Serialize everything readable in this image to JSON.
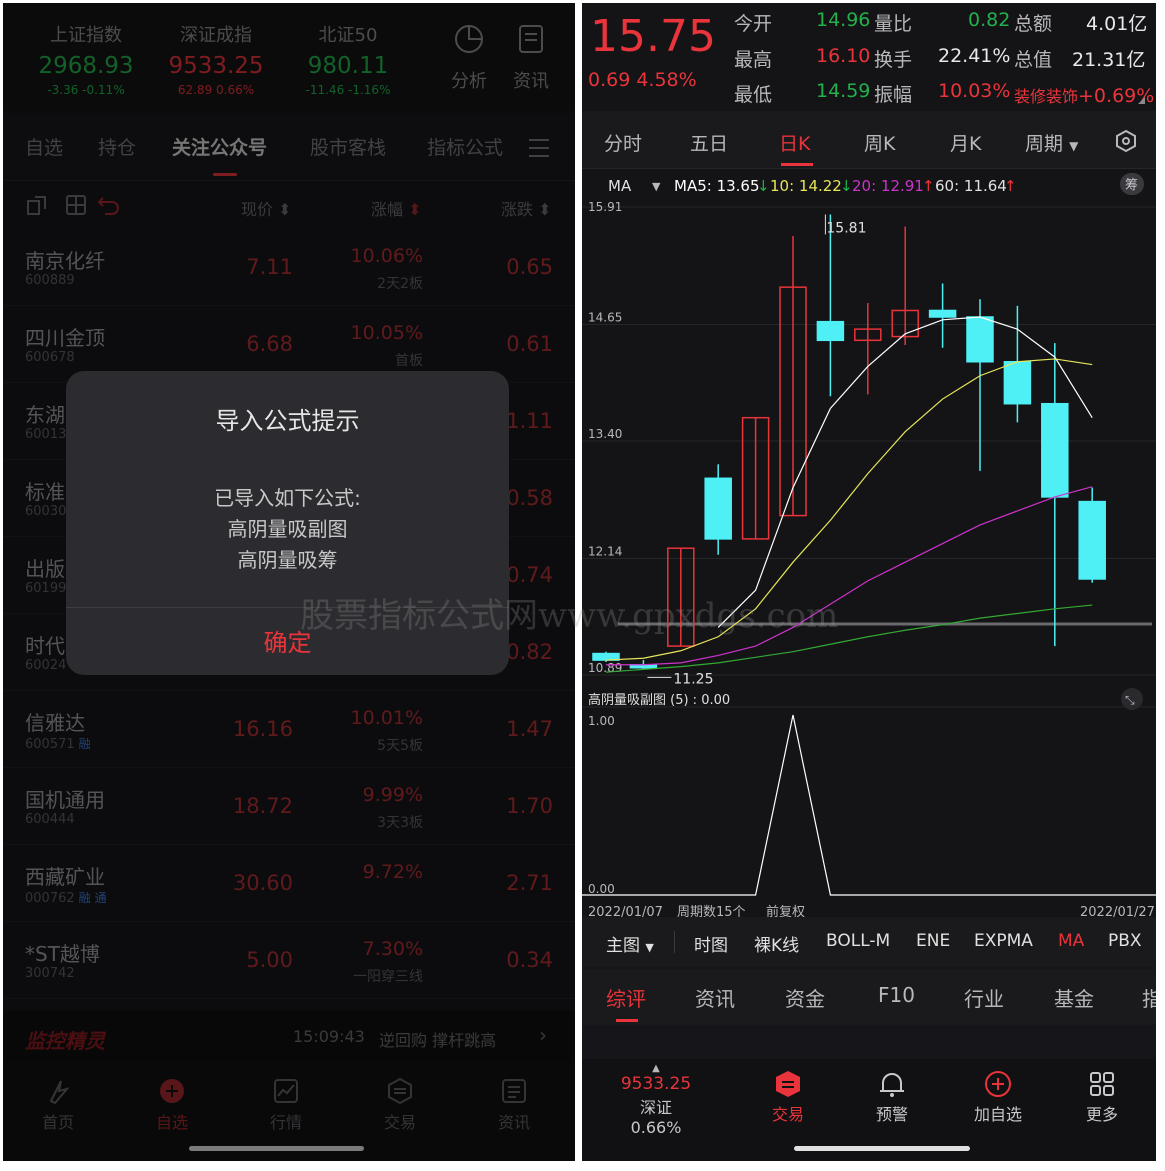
{
  "left": {
    "indices": [
      {
        "name": "上证指数",
        "value": "2968.93",
        "change": "-3.36  -0.11%",
        "up": false
      },
      {
        "name": "深证成指",
        "value": "9533.25",
        "change": "62.89  0.66%",
        "up": true
      },
      {
        "name": "北证50",
        "value": "980.11",
        "change": "-11.46  -1.16%",
        "up": false
      }
    ],
    "top_buttons": {
      "analysis": "分析",
      "news": "资讯"
    },
    "tabs": [
      "自选",
      "持仓",
      "关注公众号",
      "股市客栈",
      "指标公式"
    ],
    "columns": {
      "price": "现价",
      "pct": "涨幅",
      "chg": "涨跌"
    },
    "stocks": [
      {
        "name": "南京化纤",
        "code": "600889",
        "badge": "",
        "badge2": "",
        "price": "7.11",
        "pct": "10.06%",
        "sub": "2天2板",
        "chg": "0.65"
      },
      {
        "name": "四川金顶",
        "code": "600678",
        "badge": "",
        "badge2": "",
        "price": "6.68",
        "pct": "10.05%",
        "sub": "首板",
        "chg": "0.61"
      },
      {
        "name": "东湖",
        "code": "60013",
        "badge": "",
        "badge2": "",
        "price": "",
        "pct": "",
        "sub": "",
        "chg": "1.11"
      },
      {
        "name": "标准",
        "code": "60030",
        "badge": "",
        "badge2": "",
        "price": "",
        "pct": "",
        "sub": "",
        "chg": "0.58"
      },
      {
        "name": "出版",
        "code": "60199",
        "badge": "",
        "badge2": "",
        "price": "",
        "pct": "",
        "sub": "",
        "chg": "0.74"
      },
      {
        "name": "时代",
        "code": "60024",
        "badge": "",
        "badge2": "",
        "price": "",
        "pct": "",
        "sub": "",
        "chg": "0.82"
      },
      {
        "name": "信雅达",
        "code": "600571",
        "badge": "融",
        "badge2": "",
        "price": "16.16",
        "pct": "10.01%",
        "sub": "5天5板",
        "chg": "1.47"
      },
      {
        "name": "国机通用",
        "code": "600444",
        "badge": "",
        "badge2": "",
        "price": "18.72",
        "pct": "9.99%",
        "sub": "3天3板",
        "chg": "1.70"
      },
      {
        "name": "西藏矿业",
        "code": "000762",
        "badge": "融",
        "badge2": "通",
        "price": "30.60",
        "pct": "9.72%",
        "sub": "",
        "chg": "2.71"
      },
      {
        "name": "*ST越博",
        "code": "300742",
        "badge": "",
        "badge2": "",
        "price": "5.00",
        "pct": "7.30%",
        "sub": "一阳穿三线",
        "chg": "0.34"
      }
    ],
    "dialog": {
      "title": "导入公式提示",
      "line1": "已导入如下公式:",
      "line2": "高阴量吸副图",
      "line3": "高阴量吸筹",
      "ok": "确定"
    },
    "monitor": {
      "brand": "监控精灵",
      "time": "15:09:43",
      "text": "逆回购   撑杆跳高"
    },
    "nav": [
      "首页",
      "自选",
      "行情",
      "交易",
      "资讯"
    ]
  },
  "right": {
    "price": "15.75",
    "change": "0.69  4.58%",
    "quote": {
      "open_label": "今开",
      "open": "14.96",
      "high_label": "最高",
      "high": "16.10",
      "low_label": "最低",
      "low": "14.59",
      "vr_label": "量比",
      "vr": "0.82",
      "turn_label": "换手",
      "turn": "22.41%",
      "amp_label": "振幅",
      "amp": "10.03%",
      "amt_label": "总额",
      "amt": "4.01亿",
      "cap_label": "总值",
      "cap": "21.31亿",
      "sector": "装修装饰",
      "sector_pct": "+0.69%"
    },
    "ktabs": [
      "分时",
      "五日",
      "日K",
      "周K",
      "月K",
      "周期"
    ],
    "ma": {
      "label": "MA",
      "ma5": "MA5: 13.65",
      "ma10": "10: 14.22",
      "ma20": "20: 12.91",
      "ma60": "60: 11.64",
      "chip": "筹"
    },
    "sub_title": "高阴量吸副图 (5) : 0.00",
    "footer": {
      "start": "2022/01/07",
      "count": "周期数15个",
      "adj": "前复权",
      "end": "2022/01/27"
    },
    "subtabs": [
      "主图",
      "时图",
      "裸K线",
      "BOLL-M",
      "ENE",
      "EXPMA",
      "MA",
      "PBX"
    ],
    "ftabs": [
      "综评",
      "资讯",
      "资金",
      "F10",
      "行业",
      "基金",
      "指"
    ],
    "bottom": {
      "index_value": "9533.25",
      "index_name": "深证 0.66%",
      "trade": "交易",
      "alert": "预警",
      "add": "加自选",
      "more": "更多"
    },
    "watermark": "股票指标公式网www.gpxdgs.com",
    "colors": {
      "up": "#e8343a",
      "down": "#4ff0f5",
      "ma5": "#ffffff",
      "ma10": "#e6e65a",
      "ma20": "#cc33cc",
      "ma60": "#33aa33"
    }
  },
  "chart_data": [
    {
      "type": "candlestick",
      "title": "日K",
      "ylim": [
        10.89,
        15.91
      ],
      "y_ticks": [
        "15.91",
        "14.65",
        "13.40",
        "12.14",
        "10.89"
      ],
      "annotations": [
        "15.81",
        "11.25"
      ],
      "candles": [
        {
          "open": 11.12,
          "close": 11.05,
          "high": 11.14,
          "low": 11.03
        },
        {
          "open": 11.0,
          "close": 10.98,
          "high": 11.05,
          "low": 10.95
        },
        {
          "open": 11.2,
          "close": 12.25,
          "high": 12.25,
          "low": 11.2
        },
        {
          "open": 13.0,
          "close": 12.35,
          "high": 13.15,
          "low": 12.18
        },
        {
          "open": 12.35,
          "close": 13.65,
          "high": 13.65,
          "low": 12.35
        },
        {
          "open": 12.6,
          "close": 15.05,
          "high": 15.6,
          "low": 12.6
        },
        {
          "open": 14.68,
          "close": 14.48,
          "high": 15.83,
          "low": 13.88
        },
        {
          "open": 14.48,
          "close": 14.6,
          "high": 14.88,
          "low": 13.9
        },
        {
          "open": 14.52,
          "close": 14.8,
          "high": 15.7,
          "low": 14.43
        },
        {
          "open": 14.8,
          "close": 14.73,
          "high": 15.09,
          "low": 14.4
        },
        {
          "open": 14.73,
          "close": 14.25,
          "high": 14.92,
          "low": 13.08
        },
        {
          "open": 14.25,
          "close": 13.8,
          "high": 14.85,
          "low": 13.6
        },
        {
          "open": 13.8,
          "close": 12.8,
          "high": 14.45,
          "low": 11.2
        },
        {
          "open": 12.75,
          "close": 11.92,
          "high": 12.9,
          "low": 11.88
        }
      ],
      "ma5": [
        null,
        null,
        null,
        11.4,
        11.8,
        12.9,
        13.75,
        14.2,
        14.55,
        14.7,
        14.73,
        14.6,
        14.3,
        13.65
      ],
      "ma10": [
        11.05,
        11.07,
        11.15,
        11.3,
        11.6,
        12.1,
        12.55,
        13.05,
        13.5,
        13.85,
        14.1,
        14.25,
        14.28,
        14.22
      ],
      "ma20": [
        11.0,
        11.0,
        11.02,
        11.1,
        11.2,
        11.4,
        11.65,
        11.9,
        12.1,
        12.3,
        12.5,
        12.65,
        12.8,
        12.91
      ],
      "ma60": [
        10.92,
        10.95,
        10.98,
        11.02,
        11.08,
        11.14,
        11.22,
        11.3,
        11.37,
        11.43,
        11.5,
        11.55,
        11.6,
        11.64
      ]
    },
    {
      "type": "line",
      "title": "高阴量吸副图",
      "ylim": [
        0,
        1
      ],
      "y_ticks": [
        "1.00",
        "0.00"
      ],
      "values": [
        0,
        0,
        0,
        0,
        0,
        1,
        0,
        0,
        0,
        0,
        0,
        0,
        0,
        0
      ]
    }
  ]
}
